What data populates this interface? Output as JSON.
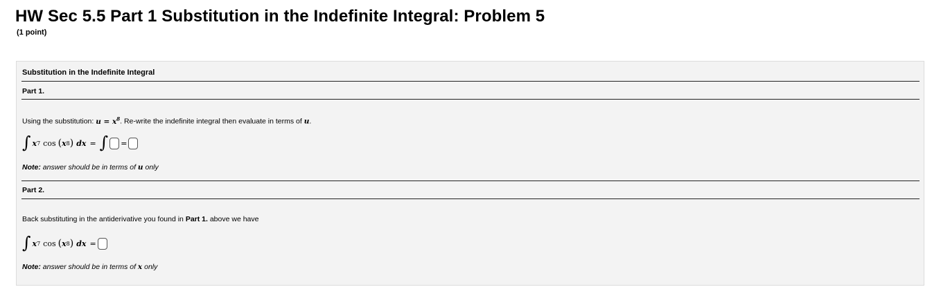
{
  "header": {
    "title": "HW Sec 5.5 Part 1 Substitution in the Indefinite Integral: Problem 5",
    "points": "(1 point)"
  },
  "panel": {
    "title": "Substitution in the Indefinite Integral",
    "part1": {
      "label": "Part 1.",
      "instruction_prefix": "Using the substitution: ",
      "substitution": "u = x",
      "substitution_exp": "8",
      "instruction_suffix": ". Re-write the indefinite integral then evaluate in terms of ",
      "instruction_var": "u",
      "instruction_end": ".",
      "integral": {
        "var": "x",
        "power": "7",
        "func": "cos",
        "inner_power": "8",
        "dx": "dx",
        "equals": "="
      },
      "note_prefix": "Note:",
      "note_text": " answer should be in terms of ",
      "note_var": "u",
      "note_suffix": " only"
    },
    "part2": {
      "label": "Part 2.",
      "instruction_prefix": "Back substituting in the antiderivative you found in ",
      "instruction_bold": "Part 1.",
      "instruction_suffix": " above we have",
      "integral": {
        "var": "x",
        "power": "7",
        "func": "cos",
        "inner_power": "8",
        "dx": "dx",
        "equals": "="
      },
      "note_prefix": "Note:",
      "note_text": " answer should be in terms of ",
      "note_var": "x",
      "note_suffix": " only"
    }
  }
}
